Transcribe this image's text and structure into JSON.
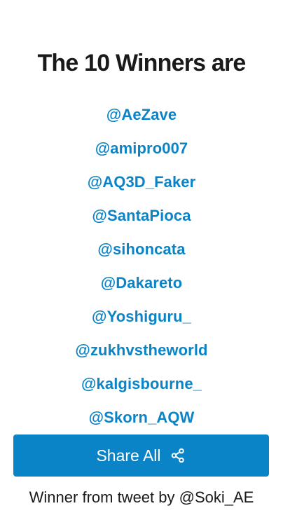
{
  "title": "The 10 Winners are",
  "winners": [
    "@AeZave",
    "@amipro007",
    "@AQ3D_Faker",
    "@SantaPioca",
    "@sihoncata",
    "@Dakareto",
    "@Yoshiguru_",
    "@zukhvstheworld",
    "@kalgisbourne_",
    "@Skorn_AQW"
  ],
  "share_button": {
    "label": "Share All",
    "icon": "share-icon"
  },
  "footer": "Winner from tweet by @Soki_AE",
  "colors": {
    "accent": "#0a84c6",
    "text": "#1a1a1a",
    "background": "#ffffff"
  }
}
